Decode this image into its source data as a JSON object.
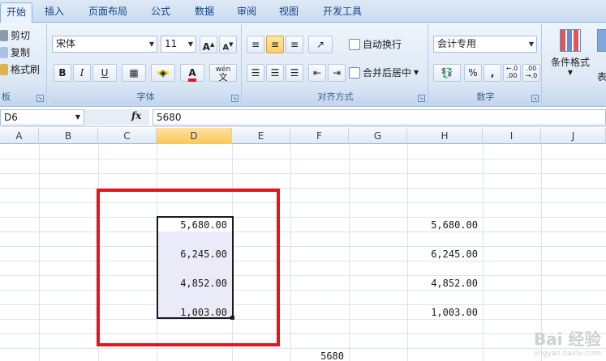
{
  "tabs": [
    "开始",
    "插入",
    "页面布局",
    "公式",
    "数据",
    "审阅",
    "视图",
    "开发工具"
  ],
  "active_tab": "开始",
  "clipboard": {
    "cut": "剪切",
    "copy": "复制",
    "format_painter": "格式刷",
    "label": "板"
  },
  "font": {
    "name": "宋体",
    "size": "11",
    "grow": "A",
    "shrink": "A",
    "bold": "B",
    "italic": "I",
    "underline": "U",
    "label": "字体",
    "phonetic": "wén"
  },
  "alignment": {
    "wrap_text": "自动换行",
    "merge_center": "合并后居中",
    "label": "对齐方式"
  },
  "number": {
    "format": "会计专用",
    "percent": "%",
    "comma": ",",
    "inc_decimal": "←.0 .00",
    "dec_decimal": ".00 →.0",
    "label": "数字"
  },
  "styles": {
    "conditional_formatting": "条件格式",
    "table": "表格"
  },
  "formula_bar": {
    "name_box": "D6",
    "fx": "fx",
    "value": "5680"
  },
  "columns": [
    "A",
    "B",
    "C",
    "D",
    "E",
    "F",
    "G",
    "H",
    "I",
    "J"
  ],
  "selected_column": "D",
  "cells": {
    "d_values": [
      "5,680.00",
      "6,245.00",
      "4,852.00",
      "1,003.00"
    ],
    "h_values": [
      "5,680.00",
      "6,245.00",
      "4,852.00",
      "1,003.00"
    ],
    "f_value": "5680"
  },
  "watermark": {
    "main": "Bai 经验",
    "sub": "jingyan.baidu.com"
  },
  "colors": {
    "highlight_box": "#e0161b",
    "selected_header": "#f8c75d",
    "ribbon": "#dde8f5"
  }
}
